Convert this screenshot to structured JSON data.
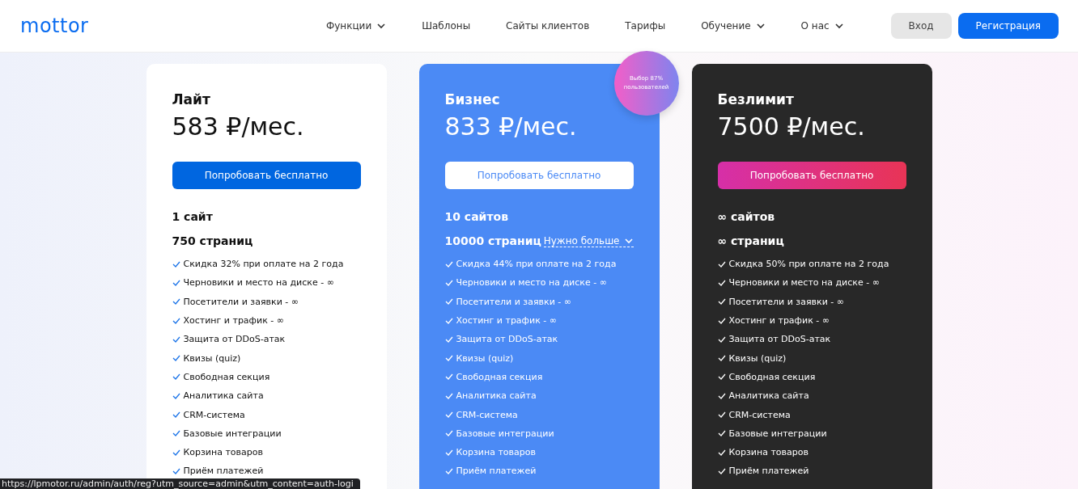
{
  "header": {
    "logo": "mottor",
    "nav": [
      {
        "label": "Функции",
        "has_menu": true
      },
      {
        "label": "Шаблоны",
        "has_menu": false
      },
      {
        "label": "Сайты клиентов",
        "has_menu": false
      },
      {
        "label": "Тарифы",
        "has_menu": false
      },
      {
        "label": "Обучение",
        "has_menu": true
      },
      {
        "label": "О нас",
        "has_menu": true
      }
    ],
    "login": "Вход",
    "register": "Регистрация"
  },
  "plans": [
    {
      "kind": "light",
      "name": "Лайт",
      "price": "583 ₽/мес.",
      "button": "Попробовать бесплатно",
      "sites": "1 сайт",
      "pages": "750 страниц",
      "features": [
        "Скидка 32% при оплате на 2 года",
        "Черновики и место на диске - ∞",
        "Посетители и заявки - ∞",
        "Хостинг и трафик - ∞",
        "Защита от DDoS-атак",
        "Квизы (quiz)",
        "Свободная секция",
        "Аналитика сайта",
        "CRM-система",
        "Базовые интеграции",
        "Корзина товаров",
        "Приём платежей"
      ]
    },
    {
      "kind": "blue",
      "name": "Бизнес",
      "price": "833 ₽/мес.",
      "button": "Попробовать бесплатно",
      "sites": "10 сайтов",
      "pages": "10000 страниц",
      "more": "Нужно больше",
      "badge": "Выбор 87% пользователей",
      "features": [
        "Скидка 44% при оплате на 2 года",
        "Черновики и место на диске - ∞",
        "Посетители и заявки - ∞",
        "Хостинг и трафик - ∞",
        "Защита от DDoS-атак",
        "Квизы (quiz)",
        "Свободная секция",
        "Аналитика сайта",
        "CRM-система",
        "Базовые интеграции",
        "Корзина товаров",
        "Приём платежей"
      ]
    },
    {
      "kind": "dark",
      "name": "Безлимит",
      "price": "7500 ₽/мес.",
      "button": "Попробовать бесплатно",
      "sites": "∞ сайтов",
      "pages": "∞ страниц",
      "features": [
        "Скидка 50% при оплате на 2 года",
        "Черновики и место на диске - ∞",
        "Посетители и заявки - ∞",
        "Хостинг и трафик - ∞",
        "Защита от DDoS-атак",
        "Квизы (quiz)",
        "Свободная секция",
        "Аналитика сайта",
        "CRM-система",
        "Базовые интеграции",
        "Корзина товаров",
        "Приём платежей"
      ]
    }
  ],
  "status_bar": "https://lpmotor.ru/admin/auth/reg?utm_source=admin&utm_content=auth-logi"
}
